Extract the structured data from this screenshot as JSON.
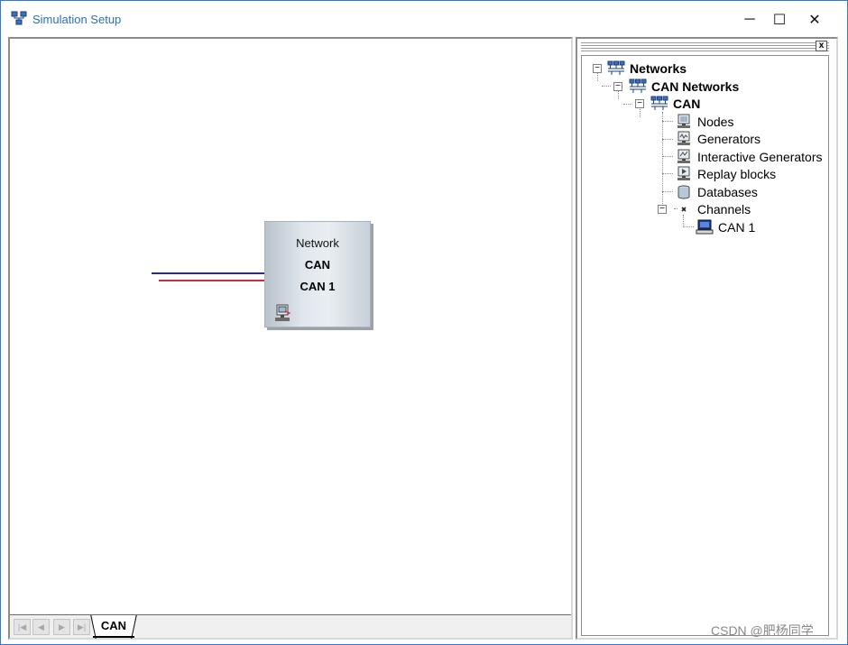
{
  "window": {
    "title": "Simulation Setup",
    "min_symbol": "─",
    "max_symbol": "☐",
    "close_symbol": "✕"
  },
  "canvas": {
    "network_block": {
      "line1": "Network",
      "line2": "CAN",
      "line3": "CAN 1"
    },
    "tabs": [
      {
        "label": "CAN",
        "active": true
      }
    ],
    "nav_buttons": [
      "first",
      "prev",
      "next",
      "last"
    ],
    "nav_symbols": [
      "|◀",
      "◀",
      "▶",
      "▶|"
    ],
    "wire_colors": {
      "bus_high": "#2a2f7a",
      "bus_low": "#c03347"
    }
  },
  "tree": {
    "close_symbol": "x",
    "items": [
      {
        "label": "Networks",
        "bold": true,
        "icon": "network-icon",
        "expanded": true
      },
      {
        "label": "CAN Networks",
        "bold": true,
        "icon": "network-icon",
        "expanded": true
      },
      {
        "label": "CAN",
        "bold": true,
        "icon": "network-icon",
        "expanded": true
      },
      {
        "label": "Nodes",
        "bold": false,
        "icon": "node-icon"
      },
      {
        "label": "Generators",
        "bold": false,
        "icon": "generator-icon"
      },
      {
        "label": "Interactive Generators",
        "bold": false,
        "icon": "interactive-generator-icon"
      },
      {
        "label": "Replay blocks",
        "bold": false,
        "icon": "replay-block-icon"
      },
      {
        "label": "Databases",
        "bold": false,
        "icon": "database-icon"
      },
      {
        "label": "Channels",
        "bold": false,
        "icon": "channels-icon",
        "expanded": true
      },
      {
        "label": "CAN 1",
        "bold": false,
        "icon": "channel-device-icon"
      }
    ]
  },
  "watermark": "CSDN @肥杨同学"
}
